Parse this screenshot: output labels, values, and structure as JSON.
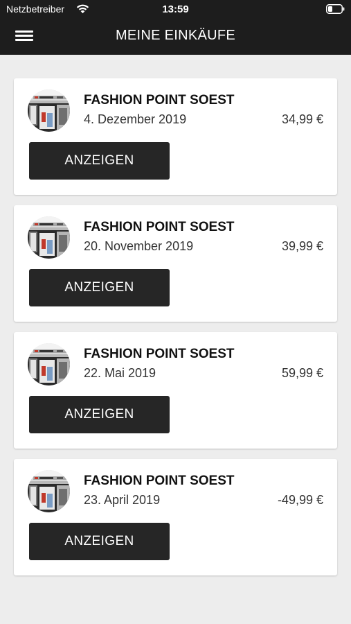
{
  "status_bar": {
    "carrier": "Netzbetreiber",
    "time": "13:59",
    "wifi_icon": "wifi-icon",
    "battery_icon": "battery-icon"
  },
  "header": {
    "menu_icon": "hamburger-menu-icon",
    "title": "MEINE EINKÄUFE",
    "background": "#1d1d1d"
  },
  "purchases": [
    {
      "store": "FASHION POINT SOEST",
      "date": "4. Dezember 2019",
      "amount": "34,99 €",
      "button_label": "ANZEIGEN",
      "avatar": "store-front-image"
    },
    {
      "store": "FASHION POINT SOEST",
      "date": "20. November 2019",
      "amount": "39,99 €",
      "button_label": "ANZEIGEN",
      "avatar": "store-front-image"
    },
    {
      "store": "FASHION POINT SOEST",
      "date": "22. Mai 2019",
      "amount": "59,99 €",
      "button_label": "ANZEIGEN",
      "avatar": "store-front-image"
    },
    {
      "store": "FASHION POINT SOEST",
      "date": "23. April 2019",
      "amount": "-49,99 €",
      "button_label": "ANZEIGEN",
      "avatar": "store-front-image"
    }
  ],
  "colors": {
    "page_background": "#ededed",
    "card_background": "#ffffff",
    "button_background": "#262626"
  }
}
